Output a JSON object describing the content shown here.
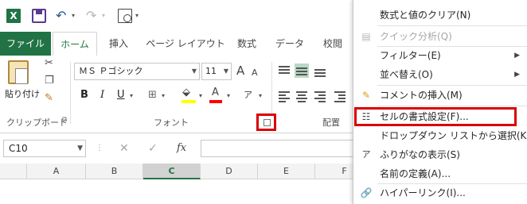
{
  "qat": {
    "app_icon": "excel-logo-icon",
    "logo_text": "X",
    "icons": [
      "save-icon",
      "undo-icon",
      "redo-icon",
      "print-preview-icon"
    ]
  },
  "tabs": [
    {
      "label": "ファイル"
    },
    {
      "label": "ホーム"
    },
    {
      "label": "挿入"
    },
    {
      "label": "ページ レイアウト"
    },
    {
      "label": "数式"
    },
    {
      "label": "データ"
    },
    {
      "label": "校閲"
    }
  ],
  "ribbon": {
    "clipboard": {
      "paste_label": "貼り付け",
      "group_label": "クリップボード"
    },
    "font": {
      "font_name": "ＭＳ Ｐゴシック",
      "font_size": "11",
      "bold": "B",
      "italic": "I",
      "underline": "U",
      "grow_font": "A",
      "shrink_font": "A",
      "font_color_letter": "A",
      "phonetic_glyph": "ア",
      "group_label": "フォント"
    },
    "alignment": {
      "group_label": "配置"
    }
  },
  "formula_bar": {
    "name_box": "C10",
    "cancel": "✕",
    "enter": "✓",
    "fx": "fx"
  },
  "sheet": {
    "columns": [
      "A",
      "B",
      "C",
      "D",
      "E",
      "F"
    ],
    "selected_column": "C"
  },
  "context_menu": {
    "items": [
      {
        "label": "数式と値のクリア(N)",
        "icon": null,
        "disabled": false,
        "submenu": false
      },
      {
        "label": "クイック分析(Q)",
        "icon": "quick-analysis-icon",
        "disabled": true,
        "submenu": false
      },
      {
        "label": "フィルター(E)",
        "icon": null,
        "disabled": false,
        "submenu": true
      },
      {
        "label": "並べ替え(O)",
        "icon": null,
        "disabled": false,
        "submenu": true
      },
      {
        "label": "コメントの挿入(M)",
        "icon": "insert-comment-icon",
        "disabled": false,
        "submenu": false
      },
      {
        "label": "セルの書式設定(F)...",
        "icon": "format-cells-icon",
        "disabled": false,
        "submenu": false
      },
      {
        "label": "ドロップダウン リストから選択(K)...",
        "icon": null,
        "disabled": false,
        "submenu": false
      },
      {
        "label": "ふりがなの表示(S)",
        "icon": "phonetic-icon",
        "disabled": false,
        "submenu": false
      },
      {
        "label": "名前の定義(A)...",
        "icon": null,
        "disabled": false,
        "submenu": false
      },
      {
        "label": "ハイパーリンク(I)...",
        "icon": "hyperlink-icon",
        "disabled": false,
        "submenu": false
      }
    ]
  },
  "colors": {
    "excel_green": "#217346",
    "highlight_red": "#d90000",
    "fill_yellow": "#ffff00",
    "font_red": "#ff0000"
  }
}
